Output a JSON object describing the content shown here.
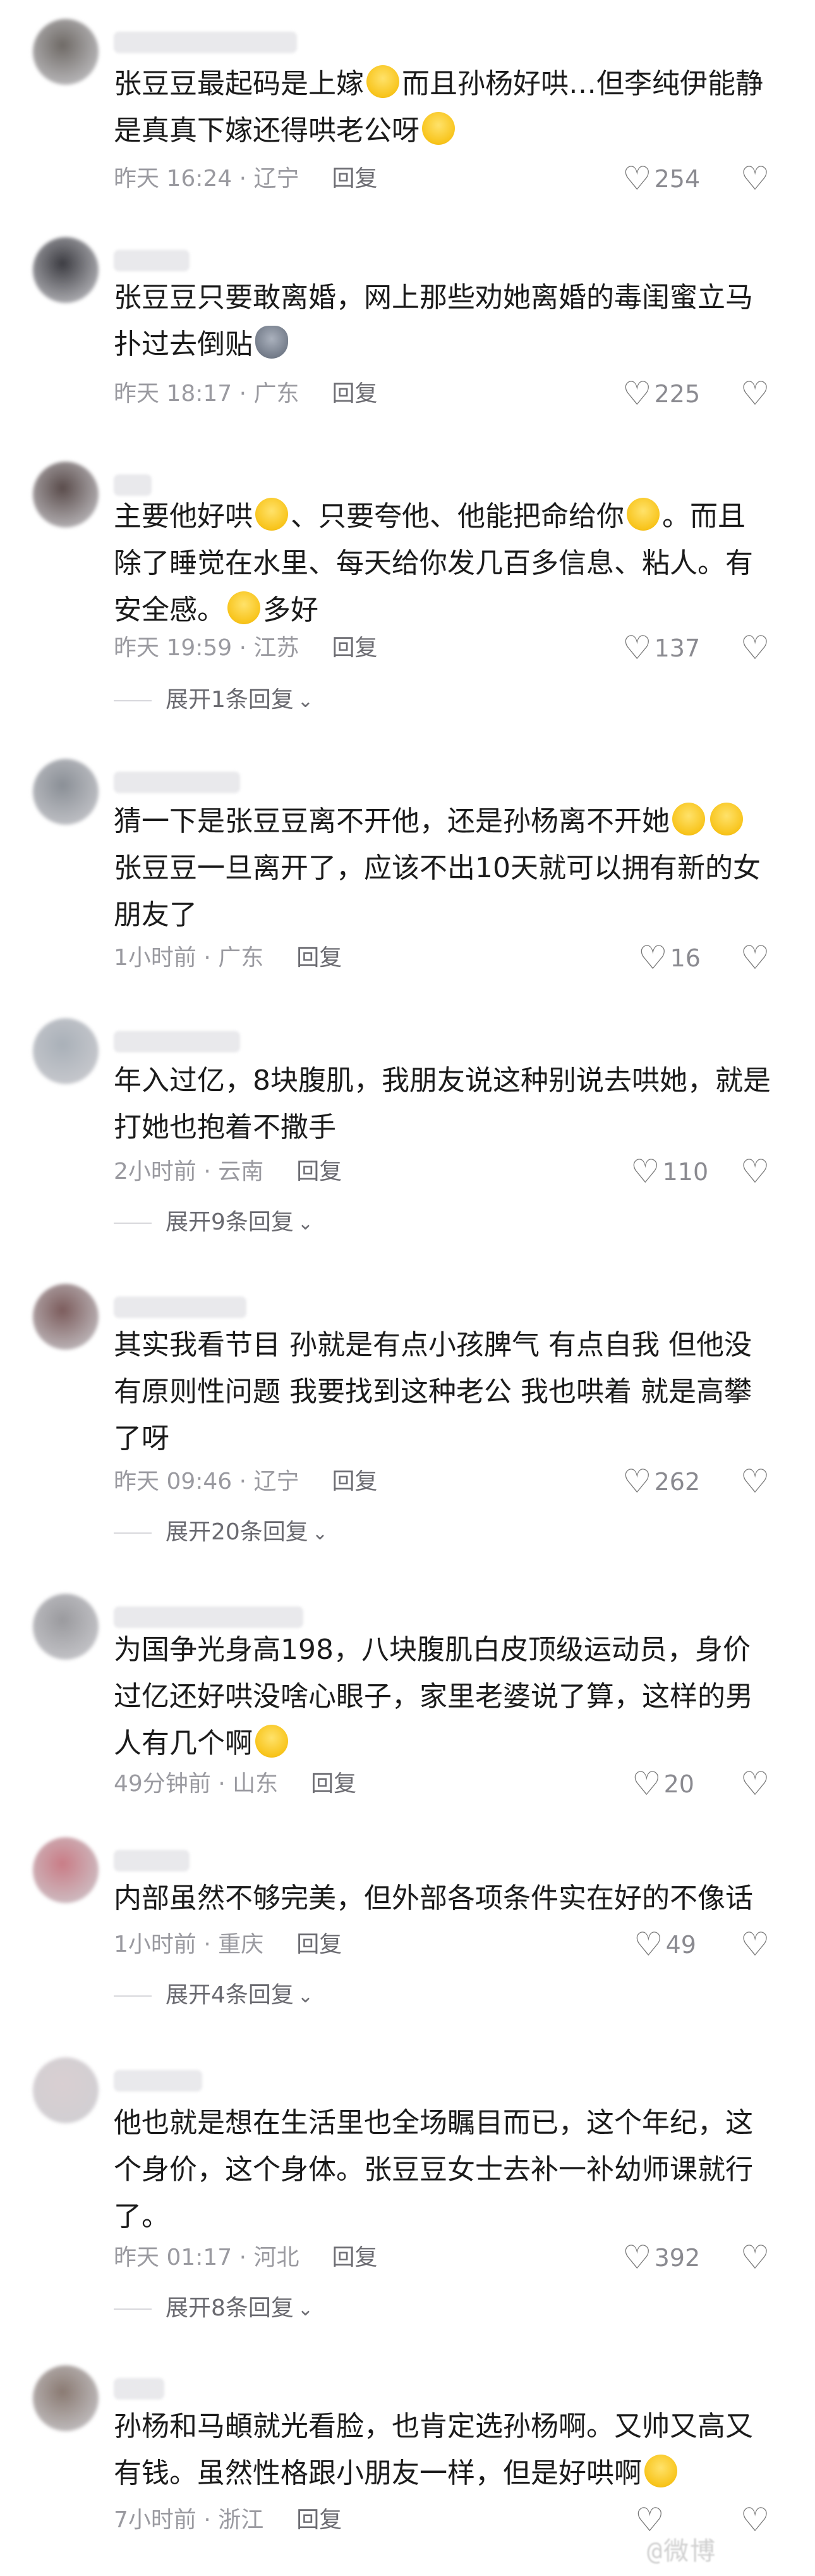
{
  "comments": [
    {
      "avatar_color": "#6f6a66",
      "parts": [
        "张豆豆最起码是上嫁",
        "而且孙杨好哄…但李纯伊能静是真真下嫁还得哄老公呀",
        ""
      ],
      "emojis": [
        "laugh-cry-emoji",
        "smile-emoji"
      ],
      "time": "昨天 16:24 · 辽宁",
      "reply": "回复",
      "likes": "254"
    },
    {
      "avatar_color": "#3c3c42",
      "parts": [
        "张豆豆只要敢离婚，网上那些劝她离婚的毒闺蜜立马扑过去倒贴",
        ""
      ],
      "emojis": [
        "raccoon-emoji"
      ],
      "time": "昨天 18:17 · 广东",
      "reply": "回复",
      "likes": "225"
    },
    {
      "avatar_color": "#5a4c4b",
      "parts": [
        "主要他好哄",
        "、只要夸他、他能把命给你",
        "。而且除了睡觉在水里、每天给你发几百多信息、粘人。有安全感。",
        "多好"
      ],
      "emojis": [
        "laugh-cry-emoji",
        "laugh-cry-emoji",
        "crying-emoji"
      ],
      "time": "昨天 19:59 · 江苏",
      "reply": "回复",
      "likes": "137",
      "expand": "展开1条回复"
    },
    {
      "avatar_color": "#8a8f96",
      "parts": [
        "猜一下是张豆豆离不开他，还是孙杨离不开她",
        "",
        "张豆豆一旦离开了，应该不出10天就可以拥有新的女朋友了"
      ],
      "emojis": [
        "grin-sweat-emoji",
        "grin-sweat-emoji"
      ],
      "time": "1小时前 · 广东",
      "reply": "回复",
      "likes": "16"
    },
    {
      "avatar_color": "#a9b0b8",
      "parts": [
        "年入过亿，8块腹肌，我朋友说这种别说去哄她，就是打她也抱着不撒手"
      ],
      "emojis": [],
      "time": "2小时前 · 云南",
      "reply": "回复",
      "likes": "110",
      "expand": "展开9条回复"
    },
    {
      "avatar_color": "#7c5c5c",
      "parts": [
        "其实我看节目 孙就是有点小孩脾气 有点自我 但他没有原则性问题 我要找到这种老公 我也哄着 就是高攀了呀"
      ],
      "emojis": [],
      "time": "昨天 09:46 · 辽宁",
      "reply": "回复",
      "likes": "262",
      "expand": "展开20条回复"
    },
    {
      "avatar_color": "#9a9a9e",
      "parts": [
        "为国争光身高198，八块腹肌白皮顶级运动员，身价过亿还好哄没啥心眼子，家里老婆说了算，这样的男人有几个啊",
        ""
      ],
      "emojis": [
        "laugh-cry-emoji"
      ],
      "time": "49分钟前 · 山东",
      "reply": "回复",
      "likes": "20"
    },
    {
      "avatar_color": "#c97c86",
      "parts": [
        "内部虽然不够完美，但外部各项条件实在好的不像话"
      ],
      "emojis": [],
      "time": "1小时前 · 重庆",
      "reply": "回复",
      "likes": "49",
      "expand": "展开4条回复"
    },
    {
      "avatar_color": "#d9cfd2",
      "parts": [
        "他也就是想在生活里也全场瞩目而已，这个年纪，这个身价，这个身体。张豆豆女士去补一补幼师课就行了。"
      ],
      "emojis": [],
      "time": "昨天 01:17 · 河北",
      "reply": "回复",
      "likes": "392",
      "expand": "展开8条回复"
    },
    {
      "avatar_color": "#8a7a72",
      "parts": [
        "孙杨和马頔就光看脸，也肯定选孙杨啊。又帅又高又有钱。虽然性格跟小朋友一样，但是好哄啊",
        ""
      ],
      "emojis": [
        "laugh-cry-emoji"
      ],
      "time": "7小时前 · 浙江",
      "reply": "回复",
      "likes": ""
    }
  ],
  "watermark": "@微博"
}
